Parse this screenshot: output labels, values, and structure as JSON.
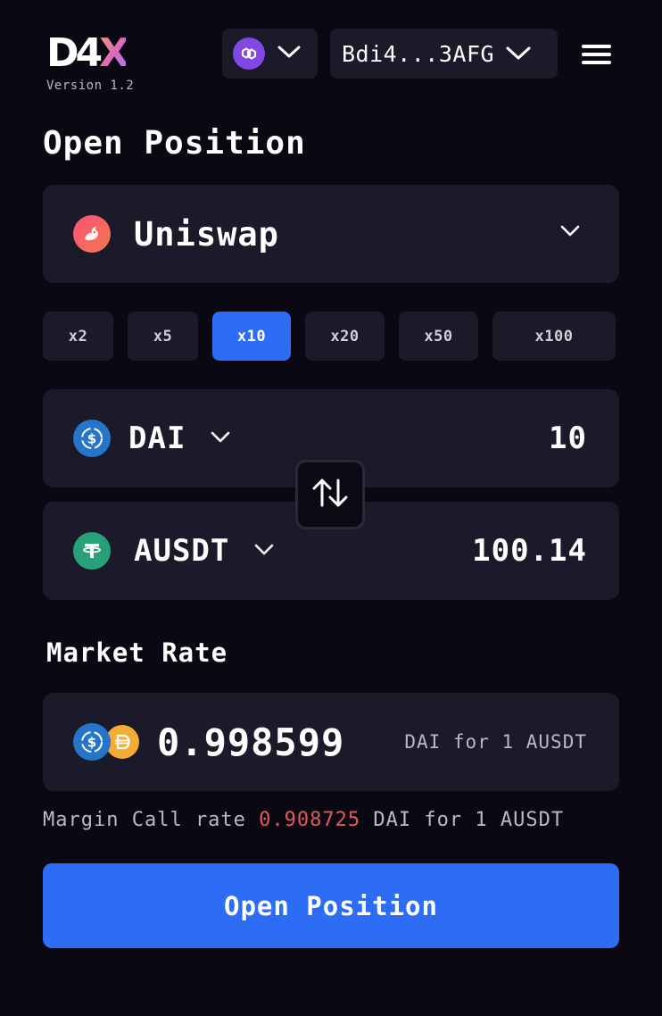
{
  "header": {
    "logo_main": "D4",
    "logo_x": "X",
    "version": "Version 1.2",
    "network_icon": "polygon-icon",
    "wallet_address": "Bdi4...3AFG",
    "menu_icon": "hamburger-menu-icon"
  },
  "title": "Open Position",
  "exchange": {
    "name": "Uniswap",
    "icon": "uniswap-icon"
  },
  "leverage": {
    "options": [
      "x2",
      "x5",
      "x10",
      "x20",
      "x50",
      "x100"
    ],
    "selected": "x10"
  },
  "from_token": {
    "symbol": "DAI",
    "amount": "10",
    "icon": "usdc-dollar-icon",
    "icon_color": "#2775ca"
  },
  "to_token": {
    "symbol": "AUSDT",
    "amount": "100.14",
    "icon": "tether-icon",
    "icon_color": "#26a17b"
  },
  "market_rate": {
    "label": "Market Rate",
    "value": "0.998599",
    "unit": "DAI for 1 AUSDT"
  },
  "margin_call": {
    "prefix": "Margin Call rate",
    "value": "0.908725",
    "suffix": "DAI for 1 AUSDT"
  },
  "action": {
    "label": "Open Position"
  },
  "colors": {
    "background": "#090813",
    "card": "#1b1a2a",
    "accent": "#2d6df6",
    "danger": "#e05a5a"
  }
}
